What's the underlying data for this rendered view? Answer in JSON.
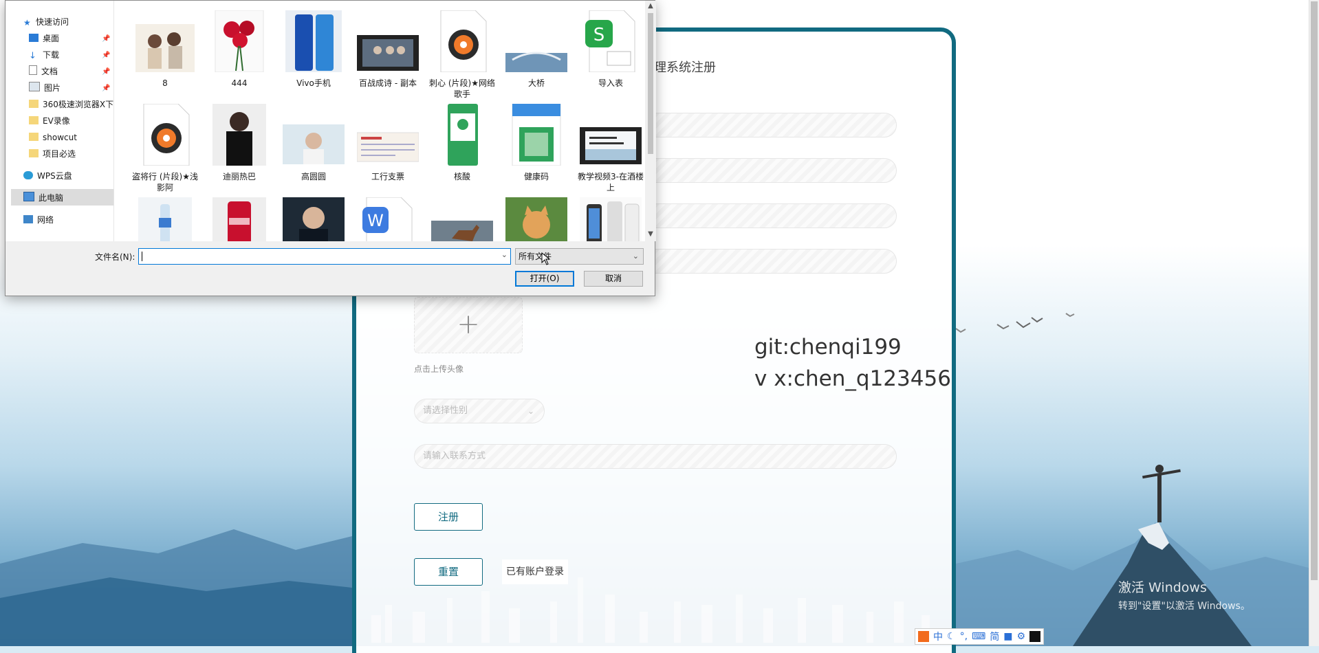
{
  "dialog": {
    "nav": [
      {
        "label": "快速访问",
        "icon": "star-icon",
        "pinned": false
      },
      {
        "label": "桌面",
        "icon": "desktop-icon",
        "pinned": true
      },
      {
        "label": "下载",
        "icon": "download-icon",
        "pinned": true
      },
      {
        "label": "文档",
        "icon": "document-icon",
        "pinned": true
      },
      {
        "label": "图片",
        "icon": "picture-icon",
        "pinned": true
      },
      {
        "label": "360极速浏览器X下!",
        "icon": "folder-icon",
        "pinned": false
      },
      {
        "label": "EV录像",
        "icon": "folder-icon",
        "pinned": false
      },
      {
        "label": "showcut",
        "icon": "folder-icon",
        "pinned": false
      },
      {
        "label": "项目必选",
        "icon": "folder-icon",
        "pinned": false
      },
      {
        "label": "WPS云盘",
        "icon": "cloud-icon",
        "pinned": false
      },
      {
        "label": "此电脑",
        "icon": "computer-icon",
        "pinned": false,
        "selected": true
      },
      {
        "label": "网络",
        "icon": "network-icon",
        "pinned": false
      }
    ],
    "files_row1": [
      {
        "name": "8",
        "icon": "photo-couple-icon"
      },
      {
        "name": "444",
        "icon": "photo-roses-icon"
      },
      {
        "name": "Vivo手机",
        "icon": "photo-phone-icon"
      },
      {
        "name": "百战成诗 - 副本",
        "icon": "video-thumbnail-icon"
      },
      {
        "name": "刺心 (片段)★网络歌手",
        "icon": "music-disc-icon"
      },
      {
        "name": "大桥",
        "icon": "photo-bridge-icon"
      },
      {
        "name": "导入表",
        "icon": "wps-sheet-icon"
      }
    ],
    "files_row2": [
      {
        "name": "盗将行 (片段)★浅影阿",
        "icon": "music-disc-icon"
      },
      {
        "name": "迪丽热巴",
        "icon": "photo-portrait-icon"
      },
      {
        "name": "高圆圆",
        "icon": "photo-portrait-icon"
      },
      {
        "name": "工行支票",
        "icon": "photo-cheque-icon"
      },
      {
        "name": "核酸",
        "icon": "photo-qr-icon"
      },
      {
        "name": "健康码",
        "icon": "photo-qr-icon"
      },
      {
        "name": "教学视频3-在酒楼上",
        "icon": "video-thumbnail-icon"
      }
    ],
    "files_row3": [
      {
        "name": "",
        "icon": "photo-bottle-icon"
      },
      {
        "name": "",
        "icon": "photo-cola-icon"
      },
      {
        "name": "",
        "icon": "photo-portrait-icon"
      },
      {
        "name": "",
        "icon": "wps-doc-icon"
      },
      {
        "name": "",
        "icon": "photo-horse-icon"
      },
      {
        "name": "",
        "icon": "photo-cat-icon"
      },
      {
        "name": "",
        "icon": "photo-phones-icon"
      }
    ],
    "filename_label": "文件名(N):",
    "filename_value": "",
    "filetype_value": "所有文件",
    "open_label": "打开(O)",
    "cancel_label": "取消"
  },
  "register": {
    "title": "理系统注册",
    "fields": [
      "",
      "",
      "",
      ""
    ],
    "upload_hint": "点击上传头像",
    "gender_placeholder": "请选择性别",
    "contact_placeholder": "请输入联系方式",
    "register_label": "注册",
    "reset_label": "重置",
    "login_link": "已有账户登录"
  },
  "watermark": {
    "line1": "git:chenqi199",
    "line2": "v x:chen_q123456"
  },
  "windows": {
    "activate_title": "激活 Windows",
    "activate_sub": "转到\"设置\"以激活 Windows。"
  },
  "ime": {
    "items": [
      "中",
      "简"
    ]
  },
  "colors": {
    "accent": "#116a80",
    "focus": "#0078d7"
  }
}
